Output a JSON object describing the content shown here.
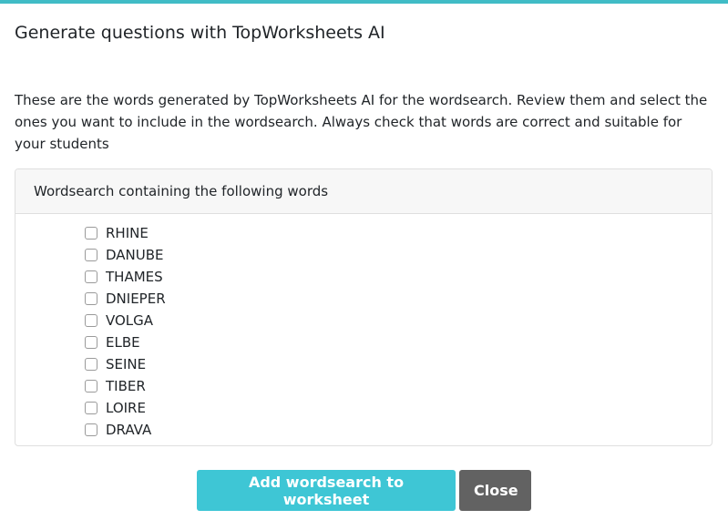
{
  "modal": {
    "title": "Generate questions with TopWorksheets AI",
    "intro": "These are the words generated by TopWorksheets AI for the wordsearch. Review them and select the ones you want to include in the wordsearch. Always check that words are correct and suitable for your students"
  },
  "card": {
    "header": "Wordsearch containing the following words",
    "words": [
      {
        "label": "RHINE",
        "checked": false
      },
      {
        "label": "DANUBE",
        "checked": false
      },
      {
        "label": "THAMES",
        "checked": false
      },
      {
        "label": "DNIEPER",
        "checked": false
      },
      {
        "label": "VOLGA",
        "checked": false
      },
      {
        "label": "ELBE",
        "checked": false
      },
      {
        "label": "SEINE",
        "checked": false
      },
      {
        "label": "TIBER",
        "checked": false
      },
      {
        "label": "LOIRE",
        "checked": false
      },
      {
        "label": "DRAVA",
        "checked": false
      }
    ]
  },
  "footer": {
    "add_label": "Add wordsearch to worksheet",
    "close_label": "Close"
  },
  "colors": {
    "accent": "#40bcc6",
    "primary_button": "#3ec6d5",
    "secondary_button": "#626262"
  }
}
